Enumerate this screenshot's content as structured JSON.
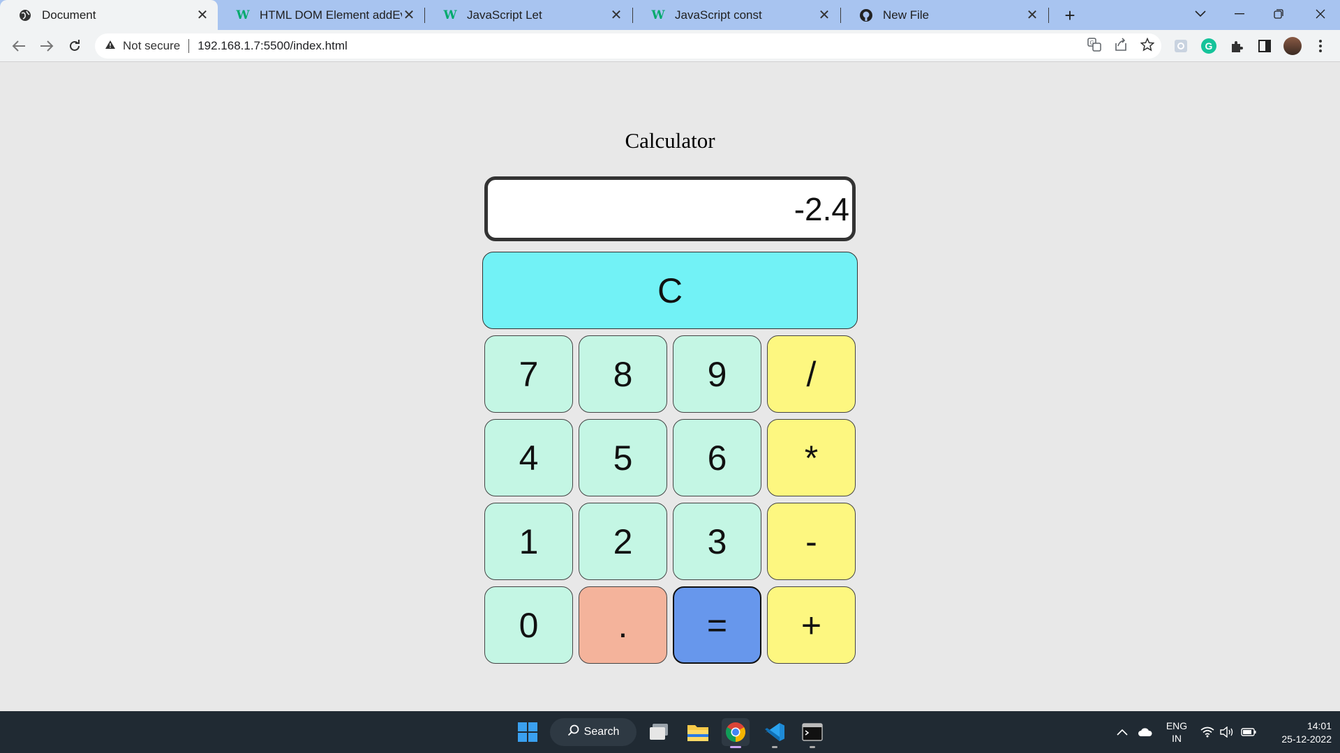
{
  "browser": {
    "tabs": [
      {
        "title": "Document",
        "icon": "globe-icon",
        "active": true
      },
      {
        "title": "HTML DOM Element addEventLis",
        "icon": "w3schools-icon",
        "active": false
      },
      {
        "title": "JavaScript Let",
        "icon": "w3schools-icon",
        "active": false
      },
      {
        "title": "JavaScript const",
        "icon": "w3schools-icon",
        "active": false
      },
      {
        "title": "New File",
        "icon": "github-icon",
        "active": false
      }
    ],
    "new_tab_label": "+",
    "security_label": "Not secure",
    "url": "192.168.1.7:5500/index.html",
    "w_logo": "W"
  },
  "calculator": {
    "title": "Calculator",
    "display_value": "-2.4",
    "clear_label": "C",
    "keys": [
      {
        "label": "7",
        "kind": "number"
      },
      {
        "label": "8",
        "kind": "number"
      },
      {
        "label": "9",
        "kind": "number"
      },
      {
        "label": "/",
        "kind": "operator"
      },
      {
        "label": "4",
        "kind": "number"
      },
      {
        "label": "5",
        "kind": "number"
      },
      {
        "label": "6",
        "kind": "number"
      },
      {
        "label": "*",
        "kind": "operator"
      },
      {
        "label": "1",
        "kind": "number"
      },
      {
        "label": "2",
        "kind": "number"
      },
      {
        "label": "3",
        "kind": "number"
      },
      {
        "label": "-",
        "kind": "operator"
      },
      {
        "label": "0",
        "kind": "number"
      },
      {
        "label": ".",
        "kind": "decimal"
      },
      {
        "label": "=",
        "kind": "equals"
      },
      {
        "label": "+",
        "kind": "operator"
      }
    ],
    "colors": {
      "clear": "#72f2f6",
      "number": "#c4f6e4",
      "operator": "#fdf780",
      "decimal": "#f4b39b",
      "equals": "#6797ec"
    }
  },
  "taskbar": {
    "search_label": "Search",
    "language": "ENG",
    "region": "IN",
    "time": "14:01",
    "date": "25-12-2022"
  }
}
